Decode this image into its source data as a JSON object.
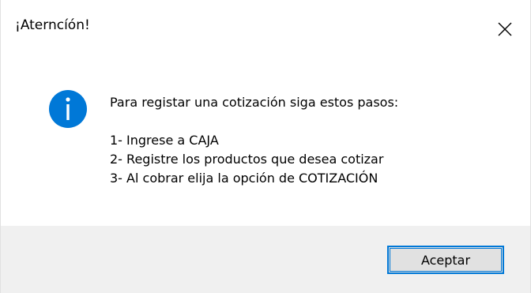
{
  "window": {
    "title": "¡Aterncíón!",
    "close_icon": "close-icon"
  },
  "message": {
    "icon": "info-icon",
    "heading": "Para registar una cotización siga estos pasos:",
    "steps": [
      "1- Ingrese a CAJA",
      "2- Registre los productos que desea cotizar",
      "3- Al cobrar elija la opción de COTIZACIÓN"
    ]
  },
  "buttons": {
    "ok_label": "Aceptar"
  },
  "colors": {
    "accent": "#0078d7",
    "footer_bg": "#f0f0f0",
    "info_icon": "#0078d7"
  }
}
